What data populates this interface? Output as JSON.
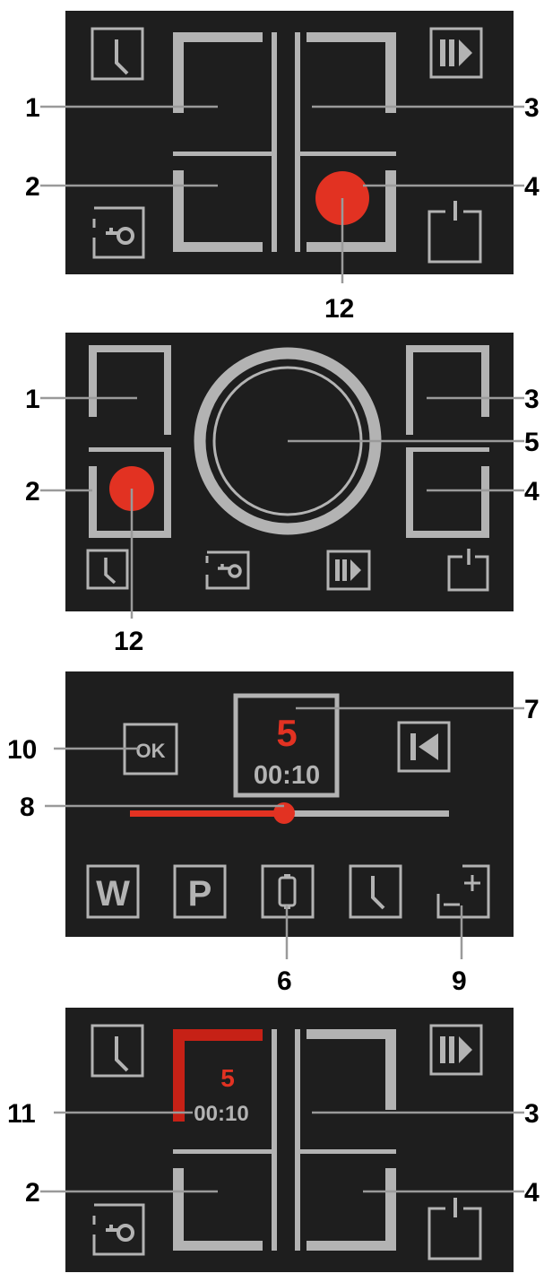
{
  "panels": [
    {
      "name": "four-zone-view",
      "callouts": [
        "1",
        "2",
        "3",
        "4",
        "12"
      ]
    },
    {
      "name": "flex-zone-view",
      "callouts": [
        "1",
        "2",
        "3",
        "4",
        "5",
        "12"
      ]
    },
    {
      "name": "power-level-view",
      "callouts": [
        "10",
        "8",
        "7",
        "6",
        "9"
      ],
      "power_level": "5",
      "timer": "00:10",
      "ok_label": "OK",
      "slider_level_percent": 48,
      "key_w": "W",
      "key_p": "P"
    },
    {
      "name": "zone-timer-view",
      "callouts": [
        "11",
        "2",
        "3",
        "4"
      ],
      "power_level": "5",
      "timer": "00:10"
    }
  ],
  "icons": [
    "clock-icon",
    "key-lock-icon",
    "boost-icon",
    "power-icon",
    "back-icon",
    "battery-icon",
    "plus-minus-icon"
  ],
  "colors": {
    "panel": "#1e1e1e",
    "zone": "#b3b3b3",
    "active": "#e23222",
    "text": "#000000"
  }
}
